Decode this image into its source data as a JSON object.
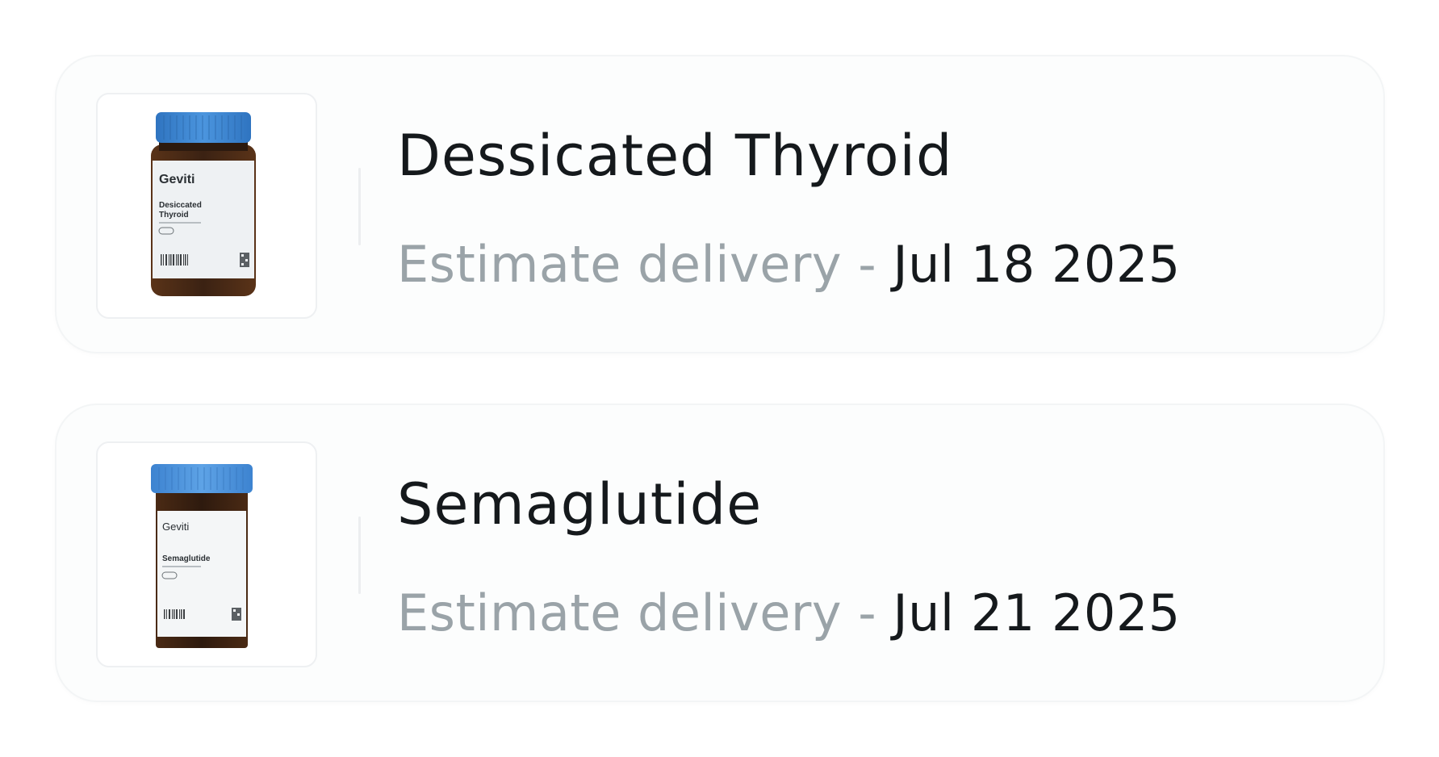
{
  "orders": [
    {
      "name": "Dessicated Thyroid",
      "delivery_label": "Estimate delivery - ",
      "delivery_date": "Jul 18 2025",
      "image": {
        "brand": "Geviti",
        "label_line1": "Desiccated",
        "label_line2": "Thyroid",
        "icon": "supplement-bottle-icon"
      }
    },
    {
      "name": "Semaglutide",
      "delivery_label": "Estimate delivery - ",
      "delivery_date": "Jul 21 2025",
      "image": {
        "brand": "Geviti",
        "label_line1": "Semaglutide",
        "label_line2": "",
        "icon": "supplement-bottle-icon"
      }
    }
  ],
  "colors": {
    "cap_blue": "#3f88d3",
    "bottle_amber": "#3a2415",
    "title_text": "#15191c",
    "muted_text": "#9aa3a8"
  }
}
